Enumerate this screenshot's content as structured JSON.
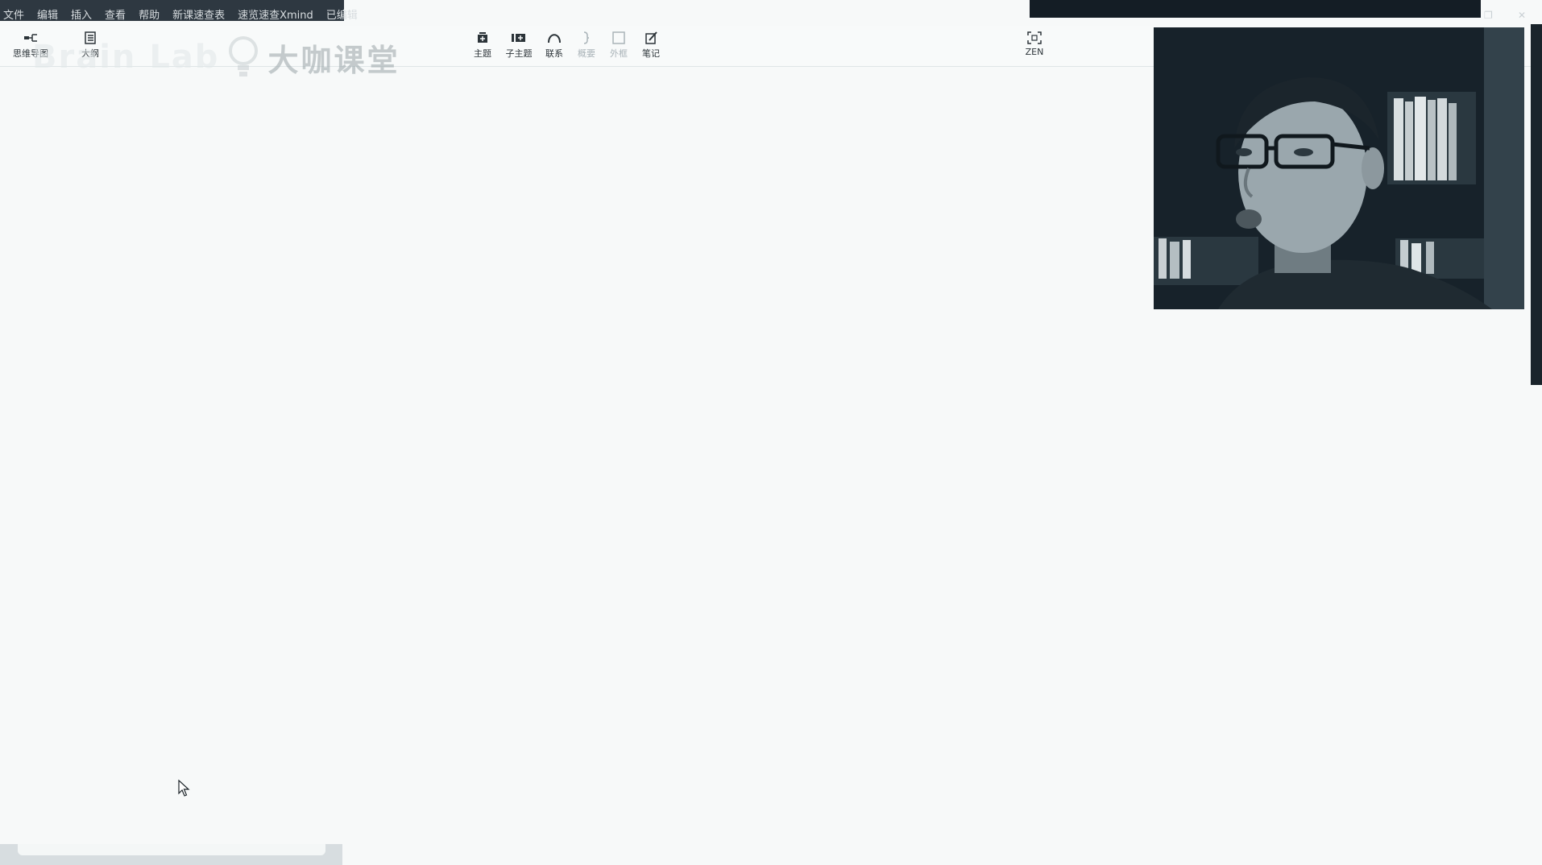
{
  "menubar": {
    "items": [
      "文件",
      "编辑",
      "插入",
      "查看",
      "帮助",
      "新课速查表",
      "速览速查Xmind",
      "已编辑"
    ]
  },
  "toolbar": {
    "left": [
      {
        "label": "思维导图",
        "icon": "mindmap-icon"
      },
      {
        "label": "大纲",
        "icon": "outline-icon"
      }
    ],
    "center": [
      {
        "label": "主题",
        "icon": "topic-icon",
        "enabled": true
      },
      {
        "label": "子主题",
        "icon": "subtopic-icon",
        "enabled": true
      },
      {
        "label": "联系",
        "icon": "relationship-icon",
        "enabled": true
      },
      {
        "label": "概要",
        "icon": "summary-icon",
        "enabled": false
      },
      {
        "label": "外框",
        "icon": "boundary-icon",
        "enabled": false
      },
      {
        "label": "笔记",
        "icon": "notes-icon",
        "enabled": true
      }
    ],
    "zen": {
      "label": "ZEN",
      "icon": "zen-fullscreen-icon"
    }
  },
  "watermark": {
    "en": "Brain Lab",
    "cn": "大咖课堂",
    "icon": "lightbulb-logo-icon"
  },
  "colors": {
    "canvas": "#f7f9f9",
    "titlebar": "#2e3841",
    "toolbar_text": "#2b3338"
  }
}
